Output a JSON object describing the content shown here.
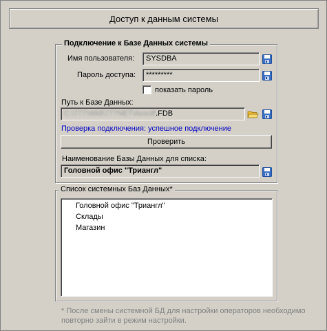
{
  "window": {
    "title": "Доступ к данным системы"
  },
  "connection_group": {
    "legend": "Подключение к Базе Данных системы",
    "username_label": "Имя пользователя:",
    "username_value": "SYSDBA",
    "password_label": "Пароль доступа:",
    "password_value": "*********",
    "show_password_label": "показать пароль",
    "show_password_checked": false,
    "db_path_label": "Путь к Базе Данных:",
    "db_path_value_blurred": "C:\\777\\Wkll\\777NET\\Axxuff",
    "db_path_value_visible": ".FDB",
    "check_status": "Проверка подключения: успешное подключение",
    "check_button": "Проверить",
    "db_name_label": "Наименование Базы Данных для списка:",
    "db_name_value": "Головной офис \"Триангл\""
  },
  "list_group": {
    "legend": "Список системных Баз Данных*",
    "items": [
      "Головной офис \"Триангл\"",
      "Склады",
      "Магазин"
    ]
  },
  "footnote": "* После смены системной БД для настройки операторов необходимо повторно зайти в режим настройки.",
  "colors": {
    "background": "#d4d0c8",
    "status_text": "#0000c0",
    "footnote_text": "#808080",
    "save_icon": "#3a6fc4"
  },
  "icons": {
    "save": "floppy-disk-icon",
    "folder": "open-folder-icon"
  }
}
